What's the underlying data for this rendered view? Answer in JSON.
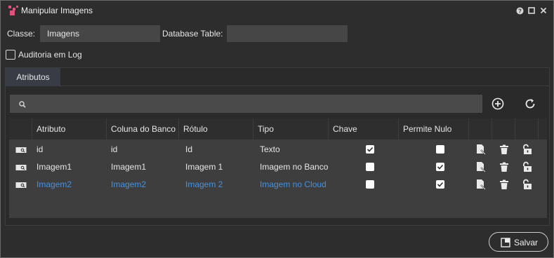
{
  "window": {
    "title": "Manipular Imagens"
  },
  "form": {
    "classe_label": "Classe:",
    "classe_value": "Imagens",
    "table_label": "Database Table:",
    "table_value": "",
    "audit_label": "Auditoria em Log"
  },
  "tabs": [
    {
      "label": "Atributos"
    }
  ],
  "search": {
    "placeholder": ""
  },
  "grid": {
    "columns": [
      "Atributo",
      "Coluna do Banco",
      "Rótulo",
      "Tipo",
      "Chave",
      "Permite Nulo"
    ],
    "rows": [
      {
        "atributo": "id",
        "coluna": "id",
        "rotulo": "Id",
        "tipo": "Texto",
        "chave": true,
        "permite_nulo": false,
        "selected": false
      },
      {
        "atributo": "Imagem1",
        "coluna": "Imagem1",
        "rotulo": "Imagem 1",
        "tipo": "Imagem no Banco",
        "chave": false,
        "permite_nulo": true,
        "selected": false
      },
      {
        "atributo": "Imagem2",
        "coluna": "Imagem2",
        "rotulo": "Imagem 2",
        "tipo": "Imagem no Cloud",
        "chave": false,
        "permite_nulo": true,
        "selected": true
      }
    ]
  },
  "footer": {
    "save_label": "Salvar"
  },
  "colors": {
    "accent": "#4a90d9",
    "icon_pink": "#e0507a"
  },
  "icons": [
    "app-icon",
    "help-icon",
    "maximize-icon",
    "close-icon",
    "search-icon",
    "add-icon",
    "refresh-icon",
    "row-key-icon",
    "edit-icon",
    "trash-icon",
    "unlock-icon",
    "save-icon"
  ]
}
